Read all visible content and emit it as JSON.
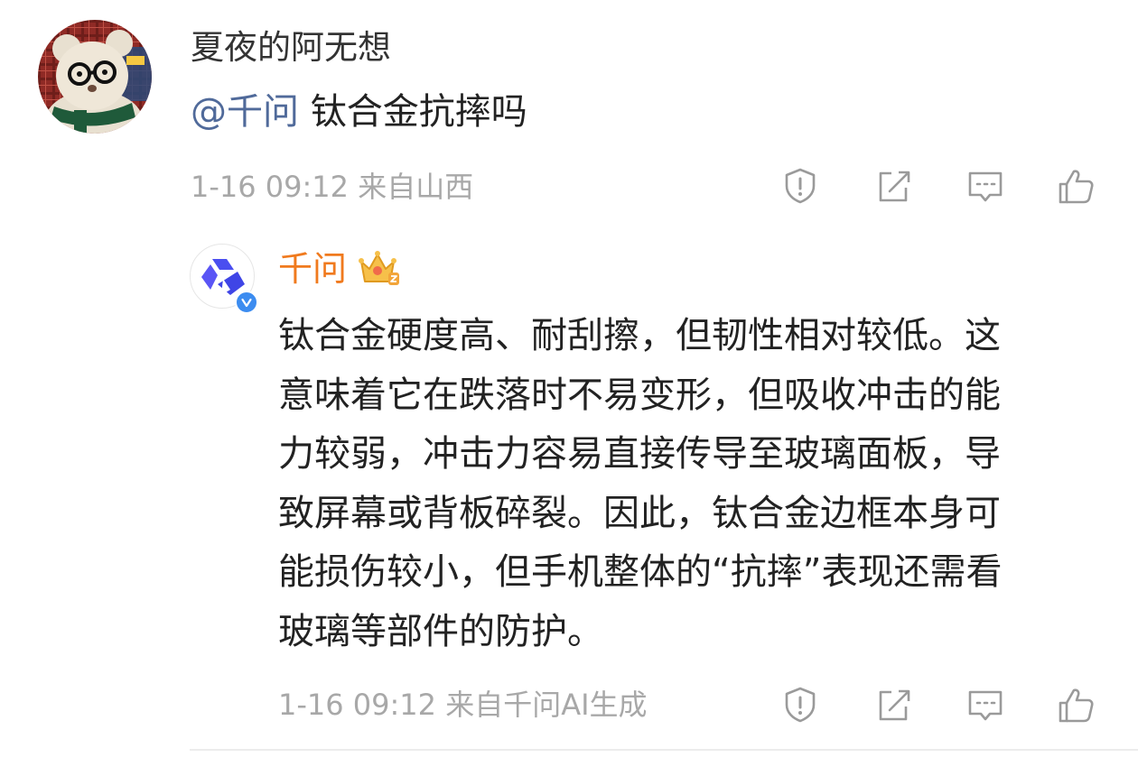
{
  "comment": {
    "author": "夏夜的阿无想",
    "mention": "@千问",
    "text": " 钛合金抗摔吗",
    "meta": "1-16 09:12  来自山西"
  },
  "reply": {
    "author": "千问",
    "lines": [
      "钛合金硬度高、耐刮擦，但韧性相对较低。这",
      "意味着它在跌落时不易变形，但吸收冲击的能",
      "力较弱，冲击力容易直接传导至玻璃面板，导",
      "致屏幕或背板碎裂。因此，钛合金边框本身可",
      "能损伤较小，但手机整体的“抗摔”表现还需看",
      "玻璃等部件的防护。"
    ],
    "meta": "1-16 09:12  来自千问AI生成"
  },
  "icons": {
    "report": "report-icon",
    "repost": "repost-icon",
    "comment": "comment-icon",
    "like": "like-icon",
    "crown": "crown-badge-icon",
    "verified": "verified-icon"
  },
  "colors": {
    "mention": "#506a9a",
    "reply_author": "#f07a1e",
    "meta": "#a8a8a8",
    "text": "#222222",
    "verified": "#3c8cf0",
    "logo": "#4a4ef0"
  }
}
